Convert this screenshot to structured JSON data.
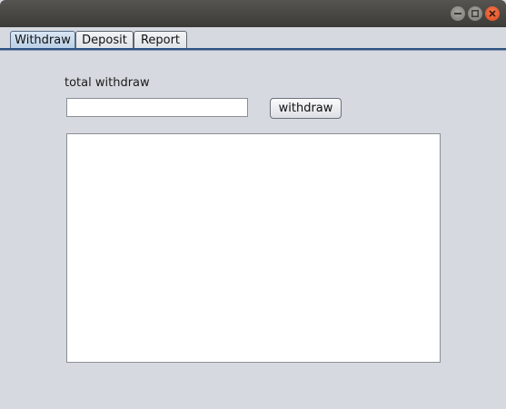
{
  "window": {
    "controls": [
      "minimize-icon",
      "maximize-icon",
      "close-icon"
    ],
    "title_bar_color": "#3c3b37",
    "close_color": "#e0481d"
  },
  "tabs": [
    {
      "label": "Withdraw",
      "active": true
    },
    {
      "label": "Deposit",
      "active": false
    },
    {
      "label": "Report",
      "active": false
    }
  ],
  "withdraw_panel": {
    "field_label": "total withdraw",
    "amount_value": "",
    "button_label": "withdraw",
    "output_text": ""
  }
}
